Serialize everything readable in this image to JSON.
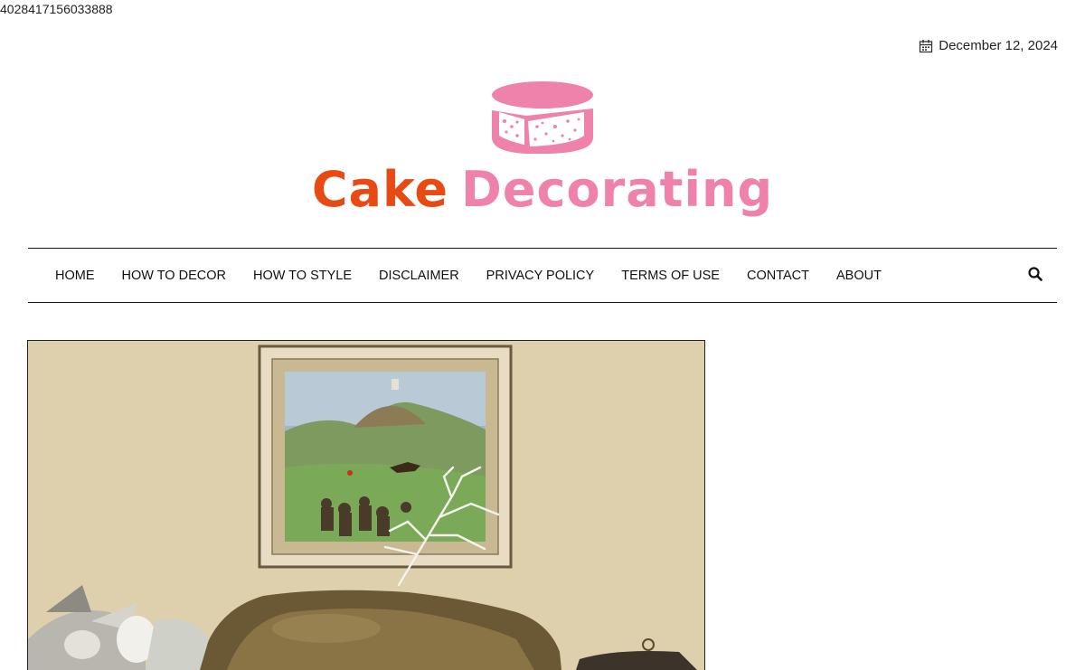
{
  "page_id": "4028417156033888",
  "header": {
    "date": "December 12, 2024",
    "date_icon": "calendar-icon",
    "logo": {
      "word1": "Cake",
      "word2": "Decorating",
      "icon": "cake-icon"
    }
  },
  "nav": {
    "items": [
      {
        "label": "HOME"
      },
      {
        "label": "HOW TO DECOR"
      },
      {
        "label": "HOW TO STYLE"
      },
      {
        "label": "DISCLAIMER"
      },
      {
        "label": "PRIVACY POLICY"
      },
      {
        "label": "TERMS OF USE"
      },
      {
        "label": "CONTACT"
      },
      {
        "label": "ABOUT"
      }
    ],
    "search_icon": "search-icon"
  },
  "colors": {
    "logo_orange": "#e84a14",
    "logo_pink": "#ee82aa"
  }
}
